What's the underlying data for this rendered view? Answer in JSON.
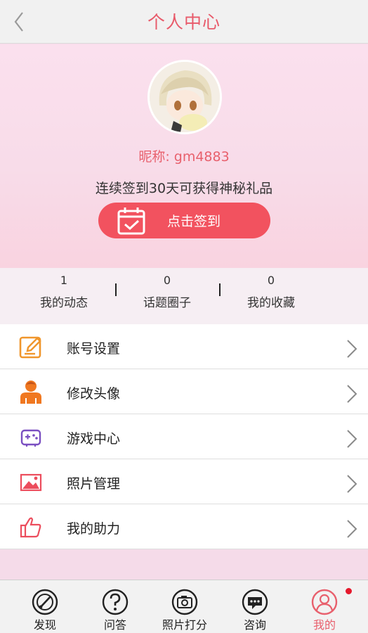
{
  "header": {
    "title": "个人中心",
    "back_icon": "chevron-left-icon"
  },
  "profile": {
    "nickname": "昵称: gm4883",
    "sign_hint": "连续签到30天可获得神秘礼品",
    "sign_button": "点击签到",
    "accent_color": "#f2525f"
  },
  "stats": [
    {
      "count": "1",
      "label": "我的动态"
    },
    {
      "count": "0",
      "label": "话题圈子"
    },
    {
      "count": "0",
      "label": "我的收藏"
    }
  ],
  "menu": [
    {
      "label": "账号设置",
      "icon": "edit-icon"
    },
    {
      "label": "修改头像",
      "icon": "person-icon"
    },
    {
      "label": "游戏中心",
      "icon": "gamepad-icon"
    },
    {
      "label": "照片管理",
      "icon": "picture-icon"
    },
    {
      "label": "我的助力",
      "icon": "thumbs-up-icon"
    }
  ],
  "tabs": [
    {
      "label": "发现",
      "icon": "compass-icon"
    },
    {
      "label": "问答",
      "icon": "question-icon"
    },
    {
      "label": "照片打分",
      "icon": "camera-icon"
    },
    {
      "label": "咨询",
      "icon": "chat-icon"
    },
    {
      "label": "我的",
      "icon": "user-icon",
      "active": true,
      "badge": true
    }
  ]
}
